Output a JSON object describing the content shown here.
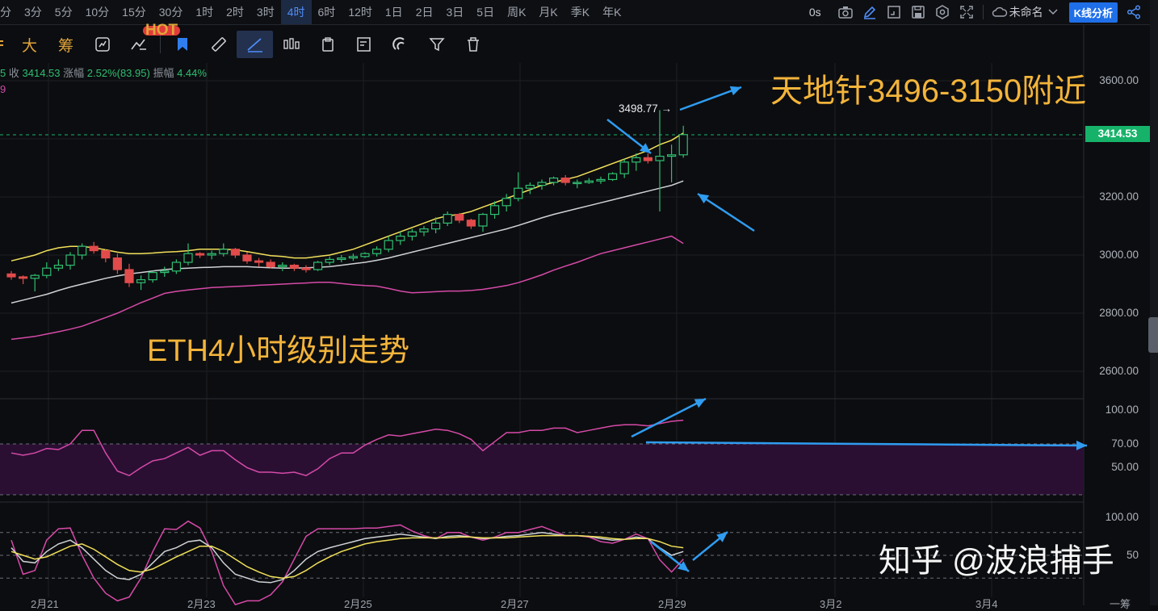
{
  "timeframes": [
    "分",
    "3分",
    "5分",
    "10分",
    "15分",
    "30分",
    "1时",
    "2时",
    "3时",
    "4时",
    "6时",
    "12时",
    "1日",
    "2日",
    "3日",
    "5日",
    "周K",
    "月K",
    "季K",
    "年K"
  ],
  "active_timeframe": "4时",
  "topright": {
    "latency": "0s",
    "layout_name": "未命名",
    "kline_button": "K线分析"
  },
  "tools": {
    "t1": "大",
    "t2": "筹",
    "hot_badge": "HOT"
  },
  "ohlc_info": {
    "prefix": "5",
    "close_label": "收",
    "close_value": "3414.53",
    "change_label": "涨幅",
    "change_value": "2.52%(83.95)",
    "amp_label": "振幅",
    "amp_value": "4.44%"
  },
  "indicator_line": "9",
  "annotations": {
    "top": "天地针3496-3150附近",
    "middle": "ETH4小时级别走势",
    "watermark": "知乎 @波浪捕手"
  },
  "price_axis": [
    "3600.00",
    "3200.00",
    "3000.00",
    "2800.00",
    "2600.00"
  ],
  "rsi_axis": [
    "100.00",
    "70.00",
    "50.00"
  ],
  "kdj_axis": [
    "100.00",
    "50"
  ],
  "last_price": "3414.53",
  "high_marker": "3498.77 →",
  "x_axis": [
    "2月21",
    "2月23",
    "2月25",
    "2月27",
    "2月29",
    "3月2",
    "3月4",
    "一筹"
  ],
  "colors": {
    "up": "#2fbf71",
    "down": "#e24b4b",
    "ma_yellow": "#f1e05a",
    "ma_white": "#cfd2d6",
    "ma_magenta": "#d64aa8",
    "annotation": "#f3b43a",
    "arrow": "#2f9cf0",
    "rsi_zone": "#2a0f33"
  },
  "chart_data": {
    "type": "candlestick",
    "price_range": [
      2500,
      3700
    ],
    "candles": [
      [
        2935,
        2945,
        2915,
        2925
      ],
      [
        2925,
        2930,
        2900,
        2920
      ],
      [
        2920,
        2935,
        2875,
        2930
      ],
      [
        2930,
        2975,
        2920,
        2955
      ],
      [
        2955,
        2985,
        2945,
        2965
      ],
      [
        2965,
        3010,
        2950,
        3000
      ],
      [
        3000,
        3040,
        2985,
        3030
      ],
      [
        3030,
        3045,
        3005,
        3015
      ],
      [
        3015,
        3020,
        2975,
        2990
      ],
      [
        2990,
        3005,
        2935,
        2950
      ],
      [
        2950,
        2970,
        2890,
        2905
      ],
      [
        2905,
        2930,
        2880,
        2915
      ],
      [
        2915,
        2945,
        2905,
        2940
      ],
      [
        2940,
        2960,
        2925,
        2945
      ],
      [
        2945,
        2985,
        2935,
        2975
      ],
      [
        2975,
        3040,
        2965,
        3005
      ],
      [
        3005,
        3010,
        2990,
        3000
      ],
      [
        3000,
        3015,
        2985,
        3005
      ],
      [
        3005,
        3040,
        2995,
        3020
      ],
      [
        3020,
        3025,
        2990,
        3000
      ],
      [
        3000,
        3010,
        2970,
        2980
      ],
      [
        2980,
        2990,
        2960,
        2975
      ],
      [
        2975,
        2985,
        2955,
        2960
      ],
      [
        2960,
        2975,
        2945,
        2965
      ],
      [
        2965,
        2970,
        2945,
        2955
      ],
      [
        2955,
        2965,
        2940,
        2950
      ],
      [
        2950,
        2980,
        2945,
        2975
      ],
      [
        2975,
        2995,
        2965,
        2985
      ],
      [
        2985,
        3000,
        2975,
        2990
      ],
      [
        2990,
        3005,
        2980,
        2995
      ],
      [
        2995,
        3010,
        2990,
        3005
      ],
      [
        3005,
        3030,
        2995,
        3020
      ],
      [
        3020,
        3065,
        3010,
        3050
      ],
      [
        3050,
        3080,
        3035,
        3065
      ],
      [
        3065,
        3090,
        3050,
        3080
      ],
      [
        3080,
        3100,
        3065,
        3090
      ],
      [
        3090,
        3130,
        3075,
        3110
      ],
      [
        3110,
        3150,
        3100,
        3140
      ],
      [
        3140,
        3145,
        3110,
        3120
      ],
      [
        3120,
        3125,
        3090,
        3100
      ],
      [
        3100,
        3145,
        3080,
        3140
      ],
      [
        3140,
        3185,
        3125,
        3170
      ],
      [
        3170,
        3210,
        3150,
        3195
      ],
      [
        3195,
        3285,
        3185,
        3230
      ],
      [
        3230,
        3250,
        3210,
        3240
      ],
      [
        3240,
        3260,
        3225,
        3250
      ],
      [
        3250,
        3270,
        3240,
        3265
      ],
      [
        3265,
        3275,
        3240,
        3250
      ],
      [
        3250,
        3260,
        3230,
        3250
      ],
      [
        3250,
        3265,
        3245,
        3255
      ],
      [
        3255,
        3270,
        3245,
        3260
      ],
      [
        3260,
        3285,
        3255,
        3280
      ],
      [
        3280,
        3330,
        3265,
        3320
      ],
      [
        3320,
        3350,
        3290,
        3335
      ],
      [
        3335,
        3350,
        3315,
        3325
      ],
      [
        3325,
        3498.77,
        3150,
        3340
      ],
      [
        3340,
        3380,
        3250,
        3345
      ],
      [
        3345,
        3445,
        3335,
        3414.53
      ]
    ],
    "ma_yellow": [
      2980,
      2990,
      3000,
      3015,
      3025,
      3030,
      3030,
      3025,
      3018,
      3010,
      3005,
      3005,
      3007,
      3010,
      3012,
      3015,
      3020,
      3020,
      3020,
      3018,
      3012,
      3005,
      2998,
      2995,
      2990,
      2990,
      2995,
      3000,
      3010,
      3020,
      3035,
      3050,
      3065,
      3080,
      3095,
      3110,
      3125,
      3135,
      3140,
      3150,
      3165,
      3180,
      3195,
      3210,
      3225,
      3240,
      3250,
      3260,
      3270,
      3285,
      3300,
      3315,
      3330,
      3345,
      3360,
      3380,
      3395,
      3420
    ],
    "ma_white": [
      2835,
      2845,
      2855,
      2865,
      2878,
      2890,
      2900,
      2910,
      2920,
      2928,
      2935,
      2940,
      2945,
      2950,
      2953,
      2955,
      2957,
      2958,
      2960,
      2960,
      2960,
      2958,
      2956,
      2955,
      2955,
      2956,
      2958,
      2960,
      2965,
      2970,
      2975,
      2982,
      2990,
      3000,
      3010,
      3020,
      3030,
      3040,
      3050,
      3060,
      3070,
      3080,
      3090,
      3102,
      3115,
      3128,
      3140,
      3150,
      3160,
      3170,
      3180,
      3190,
      3200,
      3210,
      3220,
      3230,
      3240,
      3255
    ],
    "ma_magenta": [
      2710,
      2715,
      2720,
      2728,
      2736,
      2745,
      2755,
      2770,
      2785,
      2800,
      2818,
      2836,
      2852,
      2868,
      2875,
      2880,
      2884,
      2888,
      2890,
      2892,
      2894,
      2896,
      2898,
      2900,
      2902,
      2904,
      2906,
      2906,
      2902,
      2898,
      2895,
      2893,
      2885,
      2876,
      2870,
      2872,
      2874,
      2876,
      2876,
      2878,
      2882,
      2888,
      2895,
      2905,
      2918,
      2932,
      2948,
      2962,
      2975,
      2990,
      3005,
      3015,
      3025,
      3035,
      3045,
      3055,
      3065,
      3040
    ],
    "rsi_range": [
      20,
      110
    ],
    "rsi": [
      62,
      60,
      62,
      66,
      65,
      70,
      82,
      82,
      62,
      46,
      42,
      49,
      55,
      57,
      62,
      67,
      60,
      64,
      64,
      56,
      49,
      45,
      45,
      44,
      45,
      42,
      48,
      57,
      62,
      62,
      69,
      74,
      78,
      77,
      79,
      81,
      83,
      82,
      79,
      74,
      64,
      72,
      80,
      80,
      82,
      82,
      84,
      84,
      80,
      82,
      84,
      86,
      87,
      87,
      86,
      88,
      90,
      91
    ],
    "kdj_range": [
      -20,
      120
    ],
    "kdj_k": [
      60,
      42,
      40,
      55,
      65,
      70,
      60,
      45,
      30,
      20,
      18,
      25,
      40,
      55,
      60,
      68,
      70,
      60,
      40,
      25,
      20,
      15,
      14,
      18,
      30,
      45,
      55,
      60,
      64,
      68,
      72,
      74,
      76,
      78,
      76,
      74,
      72,
      75,
      76,
      74,
      72,
      73,
      75,
      76,
      78,
      80,
      78,
      76,
      76,
      75,
      72,
      70,
      71,
      74,
      72,
      60,
      50,
      55
    ],
    "kdj_d": [
      55,
      50,
      45,
      48,
      55,
      62,
      65,
      58,
      48,
      38,
      30,
      28,
      32,
      40,
      48,
      55,
      62,
      62,
      55,
      45,
      35,
      28,
      22,
      20,
      22,
      30,
      40,
      48,
      55,
      60,
      65,
      68,
      70,
      72,
      73,
      73,
      73,
      73,
      74,
      74,
      73,
      73,
      73,
      74,
      75,
      76,
      76,
      76,
      76,
      75,
      74,
      72,
      71,
      72,
      72,
      68,
      62,
      60
    ],
    "kdj_j": [
      70,
      25,
      30,
      70,
      85,
      86,
      50,
      20,
      0,
      -10,
      -5,
      20,
      55,
      85,
      84,
      95,
      86,
      55,
      10,
      -15,
      -10,
      -10,
      -2,
      15,
      45,
      75,
      85,
      85,
      85,
      85,
      86,
      86,
      88,
      90,
      82,
      76,
      72,
      80,
      80,
      74,
      70,
      74,
      80,
      80,
      84,
      88,
      82,
      76,
      76,
      74,
      68,
      66,
      71,
      78,
      72,
      44,
      28,
      45
    ]
  }
}
